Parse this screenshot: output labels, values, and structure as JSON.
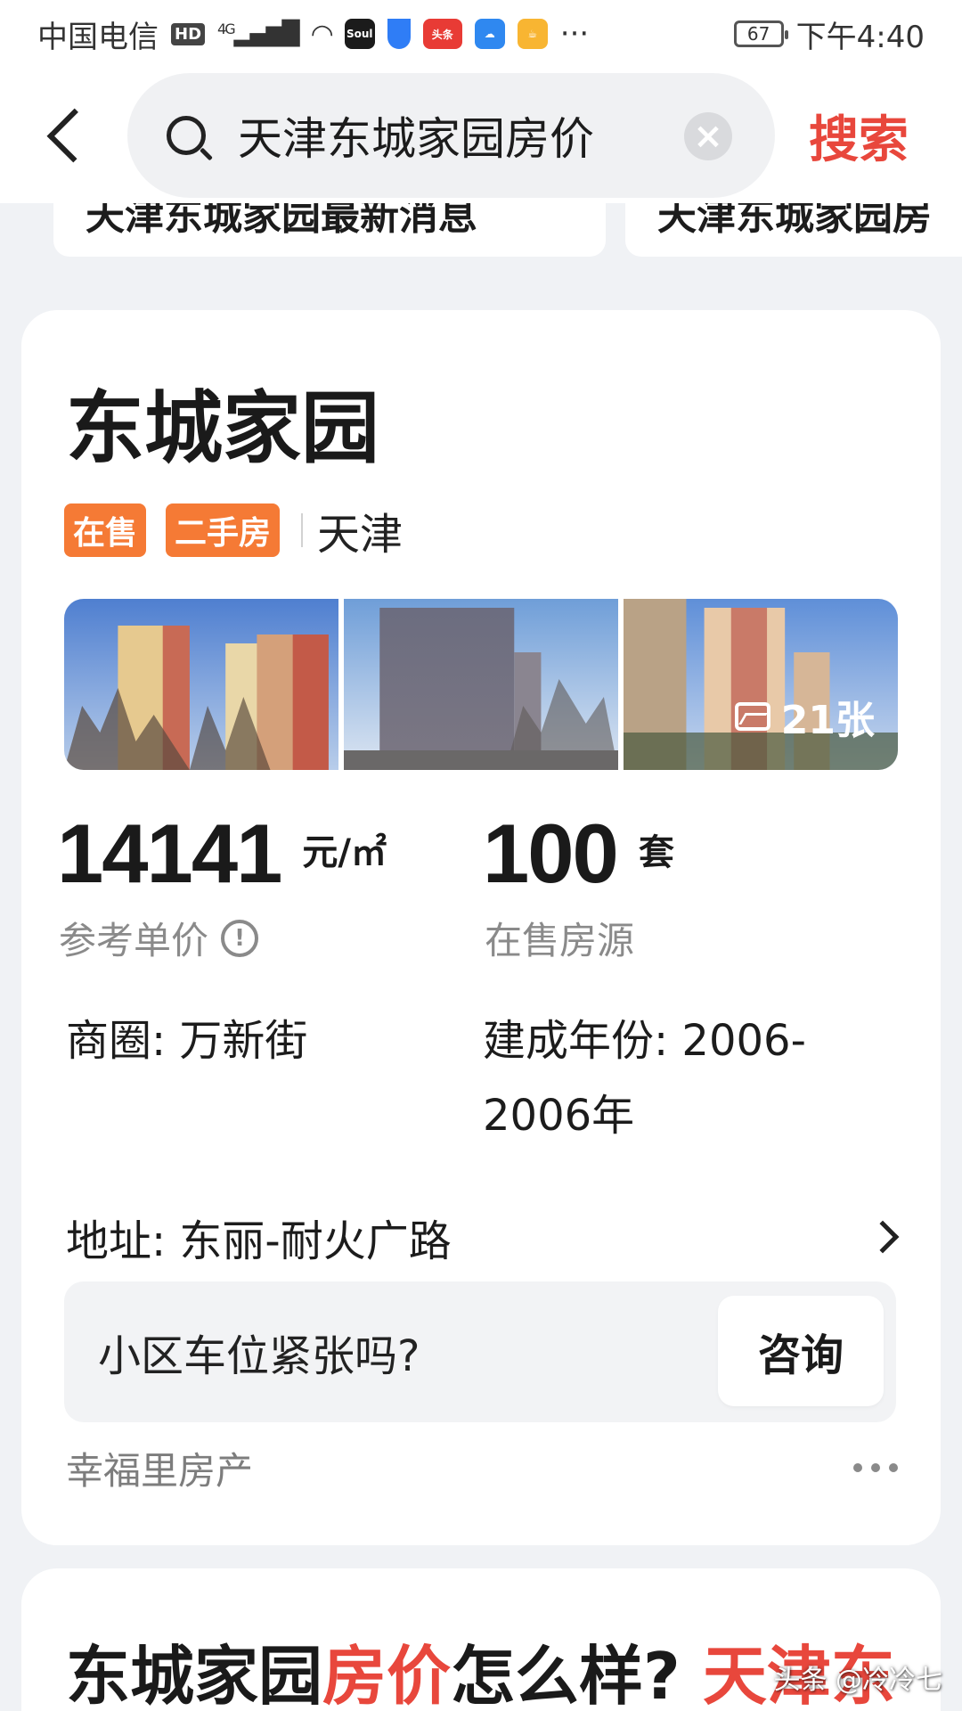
{
  "status_bar": {
    "carrier": "中国电信",
    "hd": "HD",
    "network": "4G",
    "app_soul": "Soul",
    "app_toutiao": "头条",
    "more": "···",
    "battery": "67",
    "time": "下午4:40"
  },
  "header": {
    "search_query": "天津东城家园房价",
    "clear_symbol": "×",
    "search_button": "搜索"
  },
  "chips": [
    "天津东城家园最新消息",
    "天津东城家园房"
  ],
  "listing": {
    "title": "东城家园",
    "tags": [
      "在售",
      "二手房"
    ],
    "city": "天津",
    "photo_count": "21张",
    "price": {
      "value": "14141",
      "unit": "元/㎡",
      "label": "参考单价",
      "info_symbol": "!"
    },
    "units": {
      "value": "100",
      "unit": "套",
      "label": "在售房源"
    },
    "business_district": "商圈: 万新街",
    "built_year_line1": "建成年份: 2006-",
    "built_year_line2": "2006年",
    "address": "地址: 东丽-耐火广路",
    "question": "小区车位紧张吗?",
    "consult_button": "咨询",
    "source": "幸福里房产"
  },
  "next_card": {
    "title_part1": "东城家园",
    "title_part2": "房价",
    "title_part3": "怎么样?",
    "title_part4": "天津东"
  },
  "watermark": "头条 @冷冷七",
  "colors": {
    "accent_red": "#e8473c",
    "tag_orange": "#f57a35",
    "background": "#f0f2f5"
  }
}
